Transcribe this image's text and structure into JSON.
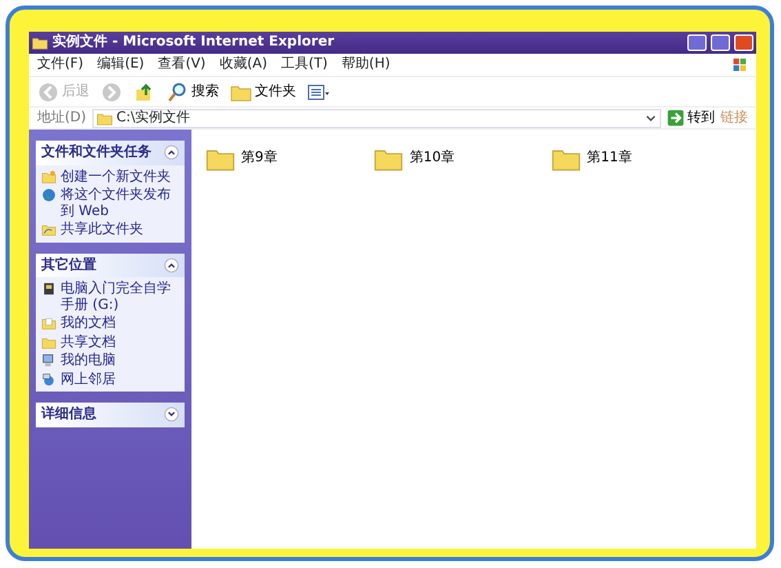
{
  "window": {
    "title": "实例文件 - Microsoft Internet Explorer"
  },
  "menu": [
    "文件(F)",
    "编辑(E)",
    "查看(V)",
    "收藏(A)",
    "工具(T)",
    "帮助(H)"
  ],
  "toolbar": [
    {
      "kind": "back",
      "label": "后退",
      "disabled": true
    },
    {
      "kind": "forward",
      "disabled": true
    },
    {
      "kind": "up"
    },
    {
      "kind": "search",
      "label": "搜索"
    },
    {
      "kind": "folders",
      "label": "文件夹"
    },
    {
      "kind": "views"
    }
  ],
  "address": {
    "label": "地址(D)",
    "value": "C:\\实例文件",
    "go": "转到",
    "links": "链接"
  },
  "task_panels": [
    {
      "title": "文件和文件夹任务",
      "expanded": true,
      "items": [
        {
          "kind": "new-folder",
          "label": "创建一个新文件夹"
        },
        {
          "kind": "publish",
          "label": "将这个文件夹发布到 Web"
        },
        {
          "kind": "share",
          "label": "共享此文件夹"
        }
      ]
    },
    {
      "title": "其它位置",
      "expanded": true,
      "items": [
        {
          "kind": "drive",
          "label": "电脑入门完全自学手册 (G:)"
        },
        {
          "kind": "documents",
          "label": "我的文档"
        },
        {
          "kind": "folder",
          "label": "共享文档"
        },
        {
          "kind": "computer",
          "label": "我的电脑"
        },
        {
          "kind": "network",
          "label": "网上邻居"
        }
      ]
    },
    {
      "title": "详细信息",
      "expanded": false
    }
  ],
  "files": [
    {
      "name": "第9章"
    },
    {
      "name": "第10章"
    },
    {
      "name": "第11章"
    }
  ]
}
